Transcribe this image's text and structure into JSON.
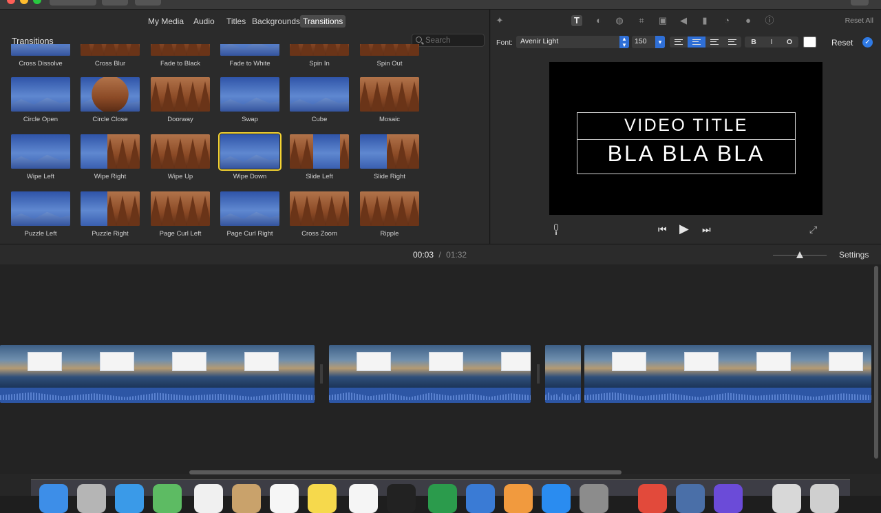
{
  "media_tabs": [
    "My Media",
    "Audio",
    "Titles",
    "Backgrounds",
    "Transitions"
  ],
  "browser": {
    "section_title": "Transitions",
    "search_placeholder": "Search",
    "transitions": [
      [
        "Cross Dissolve",
        "Cross Blur",
        "Fade to Black",
        "Fade to White",
        "Spin In",
        "Spin Out"
      ],
      [
        "Circle Open",
        "Circle Close",
        "Doorway",
        "Swap",
        "Cube",
        "Mosaic"
      ],
      [
        "Wipe Left",
        "Wipe Right",
        "Wipe Up",
        "Wipe Down",
        "Slide Left",
        "Slide Right"
      ],
      [
        "Puzzle Left",
        "Puzzle Right",
        "Page Curl Left",
        "Page Curl Right",
        "Cross Zoom",
        "Ripple"
      ]
    ],
    "selected": "Wipe Down"
  },
  "viewer": {
    "reset_all": "Reset All",
    "font_label": "Font:",
    "font_name": "Avenir Light",
    "font_size": "150",
    "bold": "B",
    "italic": "I",
    "outline": "O",
    "text_color": "#ffffff",
    "reset": "Reset",
    "title_line1": "VIDEO TITLE",
    "title_line2": "BLA BLA BLA"
  },
  "timeline": {
    "current_time": "00:03",
    "separator": "/",
    "total_time": "01:32",
    "settings": "Settings"
  },
  "colors": {
    "accent": "#2f6fd6",
    "selection": "#f6d532",
    "waveform": "#2d56a5"
  }
}
